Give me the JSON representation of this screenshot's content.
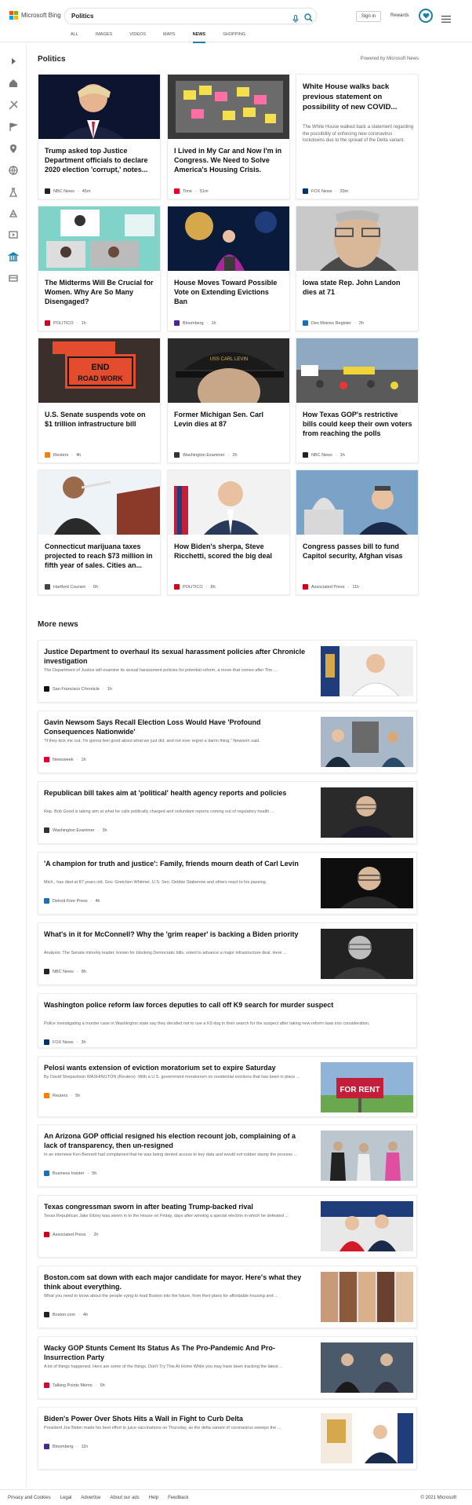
{
  "brand": {
    "name": "Microsoft Bing",
    "logo_colors": [
      "#f25022",
      "#7fba00",
      "#00a4ef",
      "#ffb900"
    ],
    "accent": "#1a7fa8"
  },
  "search": {
    "value": "Politics"
  },
  "header": {
    "signin_label": "Sign in",
    "rewards_label": "Rewards",
    "tabs": [
      {
        "label": "ALL"
      },
      {
        "label": "IMAGES"
      },
      {
        "label": "VIDEOS"
      },
      {
        "label": "MAPS"
      },
      {
        "label": "NEWS"
      },
      {
        "label": "SHOPPING"
      }
    ],
    "active_tab": "NEWS"
  },
  "rail_icons": [
    "expand-icon",
    "home-icon",
    "sports-icon",
    "flag-icon",
    "location-icon",
    "globe-icon",
    "science-icon",
    "technology-icon",
    "entertainment-icon",
    "politics-icon",
    "business-icon"
  ],
  "main": {
    "section_title": "Politics",
    "powered_by": "Powered by Microsoft News"
  },
  "cards": [
    {
      "title": "Trump asked top Justice Department officials to declare 2020 election 'corrupt,' notes...",
      "source": "NBC News",
      "age": "45m",
      "src_color": "#222222"
    },
    {
      "title": "I Lived in My Car and Now I'm in Congress. We Need to Solve America's Housing Crisis.",
      "source": "Time",
      "age": "51m",
      "src_color": "#e4002b"
    },
    {
      "title": "White House walks back previous statement on possibility of new COVID...",
      "snippet": "The White House walked back a statement regarding the possibility of enforcing new coronavirus lockdowns due to the spread of the Delta variant.",
      "source": "FOX News",
      "age": "33m",
      "src_color": "#003366"
    },
    {
      "title": "The Midterms Will Be Crucial for Women. Why Are So Many Disengaged?",
      "source": "POLITICO",
      "age": "1h",
      "src_color": "#d0021b"
    },
    {
      "title": "House Moves Toward Possible Vote on Extending Evictions Ban",
      "source": "Bloomberg",
      "age": "1h",
      "src_color": "#472a91"
    },
    {
      "title": "Iowa state Rep. John Landon dies at 71",
      "source": "Des Moines Register",
      "age": "2h",
      "src_color": "#1f6fb5"
    },
    {
      "title": "U.S. Senate suspends vote on $1 trillion infrastructure bill",
      "source": "Reuters",
      "age": "4h",
      "src_color": "#ff8000"
    },
    {
      "title": "Former Michigan Sen. Carl Levin dies at 87",
      "source": "Washington Examiner",
      "age": "2h",
      "src_color": "#333333"
    },
    {
      "title": "How Texas GOP's restrictive bills could keep their own voters from reaching the polls",
      "source": "NBC News",
      "age": "1h",
      "src_color": "#222222"
    },
    {
      "title": "Connecticut marijuana taxes projected to reach $73 million in fifth year of sales. Cities an...",
      "source": "Hartford Courant",
      "age": "6h",
      "src_color": "#444444"
    },
    {
      "title": "How Biden's sherpa, Steve Ricchetti, scored the big deal",
      "source": "POLITICO",
      "age": "8h",
      "src_color": "#d0021b"
    },
    {
      "title": "Congress passes bill to fund Capitol security, Afghan visas",
      "source": "Associated Press",
      "age": "11h",
      "src_color": "#d0021b"
    }
  ],
  "more_news": {
    "title": "More news",
    "items": [
      {
        "title": "Justice Department to overhaul its sexual harassment policies after Chronicle investigation",
        "snippet": "The Department of Justice will examine its sexual harassment policies for potential reform, a move that comes after The ...",
        "source": "San Francisco Chronicle",
        "age": "1h",
        "src_color": "#111111"
      },
      {
        "title": "Gavin Newsom Says Recall Election Loss Would Have 'Profound Consequences Nationwide'",
        "snippet": "\"If they kick me out, I'm gonna feel good about what we just did, and not ever regret a damn thing,\" Newsom said.",
        "source": "Newsweek",
        "age": "1h",
        "src_color": "#e4002b"
      },
      {
        "title": "Republican bill takes aim at 'political' health agency reports and policies",
        "snippet": "Rep. Bob Good is taking aim at what he calls politically charged and redundant reports coming out of regulatory health ...",
        "source": "Washington Examiner",
        "age": "3h",
        "src_color": "#333333"
      },
      {
        "title": "'A champion for truth and justice': Family, friends mourn death of Carl Levin",
        "snippet": "Mich., has died at 87 years old. Gov. Gretchen Whitmer, U.S. Sen. Debbie Stabenow and others react to his passing.",
        "source": "Detroit Free Press",
        "age": "4h",
        "src_color": "#1f6fb5"
      },
      {
        "title": "What's in it for McConnell? Why the 'grim reaper' is backing a Biden priority",
        "snippet": "Analysis: The Senate minority leader, known for blocking Democratic bills, voted to advance a major infrastructure deal. Here ...",
        "source": "NBC News",
        "age": "8h",
        "src_color": "#222222"
      },
      {
        "title": "Washington police reform law forces deputies to call off K9 search for murder suspect",
        "snippet": "Police investigating a murder case in Washington state say they decided not to use a K9 dog in their search for the suspect after taking new reform laws into consideration.",
        "source": "FOX News",
        "age": "3h",
        "src_color": "#003366"
      },
      {
        "title": "Pelosi wants extension of eviction moratorium set to expire Saturday",
        "snippet": "By David Shepardson WASHINGTON (Reuters) -With a U.S. government moratorium on residential evictions that has been in place ...",
        "source": "Reuters",
        "age": "5h",
        "src_color": "#ff8000"
      },
      {
        "title": "An Arizona GOP official resigned his election recount job, complaining of a lack of transparency, then un-resigned",
        "snippet": "In an interview Ken Bennett had complained that he was being denied access to key data and would not rubber stamp the process ...",
        "source": "Business Insider",
        "age": "5h",
        "src_color": "#1f6fb5"
      },
      {
        "title": "Texas congressman sworn in after beating Trump-backed rival",
        "snippet": "Texas Republican Jake Ellzey was sworn in to the House on Friday, days after winning a special election in which he defeated ...",
        "source": "Associated Press",
        "age": "2h",
        "src_color": "#d0021b"
      },
      {
        "title": "Boston.com sat down with each major candidate for mayor. Here's what they think about everything.",
        "snippet": "What you need to know about the people vying to lead Boston into the future, from their plans for affordable housing and ...",
        "source": "Boston.com",
        "age": "4h",
        "src_color": "#222222"
      },
      {
        "title": "Wacky GOP Stunts Cement Its Status As The Pro-Pandemic And Pro-Insurrection Party",
        "snippet": "A lot of things happened. Here are some of the things. Don't Try This At Home While you may have been tracking the latest ...",
        "source": "Talking Points Memo",
        "age": "5h",
        "src_color": "#c8102e"
      },
      {
        "title": "Biden's Power Over Shots Hits a Wall in Fight to Curb Delta",
        "snippet": "President Joe Biden made his best effort to juice vaccinations on Thursday, as the delta variant of coronavirus sweeps the ...",
        "source": "Bloomberg",
        "age": "11h",
        "src_color": "#472a91"
      }
    ]
  },
  "footer": {
    "links": [
      {
        "label": "Privacy and Cookies"
      },
      {
        "label": "Legal"
      },
      {
        "label": "Advertise"
      },
      {
        "label": "About our ads"
      },
      {
        "label": "Help"
      },
      {
        "label": "Feedback"
      }
    ],
    "copyright": "© 2021 Microsoft"
  }
}
